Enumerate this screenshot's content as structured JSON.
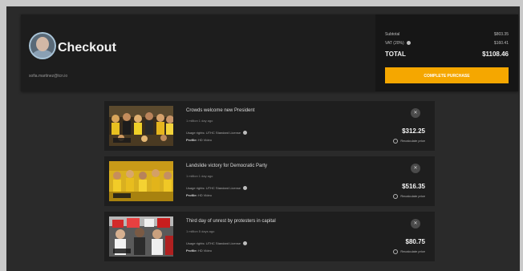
{
  "header": {
    "title": "Checkout",
    "email": "sofia.martinez@tcn.io"
  },
  "summary": {
    "subtotal_label": "Subtotal",
    "subtotal_value": "$803.35",
    "vat_label": "VAT (20%)",
    "vat_value": "$160.41",
    "total_label": "TOTAL",
    "total_value": "$1108.46",
    "complete_label": "COMPLETE PURCHASE"
  },
  "items": [
    {
      "title": "Crowds welcome new President",
      "time": "1 million 1 day ago",
      "usage_label": "Usage rights:",
      "usage_value": "UTHC Standard License",
      "profile_label": "Profile:",
      "profile_value": "HD Video",
      "price": "$312.25",
      "recalc": "Recalculate price"
    },
    {
      "title": "Landslide victory for Democratic Party",
      "time": "1 million 1 day ago",
      "usage_label": "Usage rights:",
      "usage_value": "UTHC Standard License",
      "profile_label": "Profile:",
      "profile_value": "HD Video",
      "price": "$516.35",
      "recalc": "Recalculate price"
    },
    {
      "title": "Third day of unrest by protesters in capital",
      "time": "1 million 5 days ago",
      "usage_label": "Usage rights:",
      "usage_value": "UTHC Standard License",
      "profile_label": "Profile:",
      "profile_value": "HD Video",
      "price": "$80.75",
      "recalc": "Recalculate price"
    }
  ],
  "colors": {
    "accent": "#f5a700",
    "card_bg": "#1e1e1e",
    "page_bg": "#2a2a2a"
  }
}
